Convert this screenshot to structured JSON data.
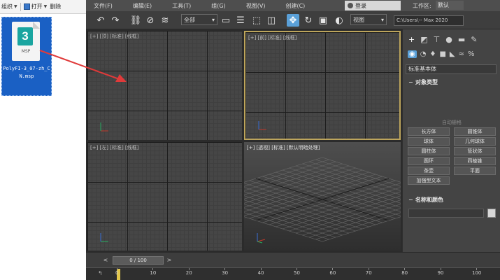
{
  "explorer": {
    "toolbar": {
      "organize": "组织",
      "open": "打开",
      "delete": "删除"
    },
    "file": {
      "badge": "3",
      "ext": "MSP",
      "name": "PolyFI-3_07-zh_CN.msp"
    }
  },
  "app": {
    "menu": [
      "文件(F)",
      "编辑(E)",
      "工具(T)",
      "组(G)",
      "视图(V)",
      "创建(C)"
    ],
    "signin_label": "登录",
    "workspace_label": "工作区:",
    "workspace_value": "默认",
    "toolbar": {
      "selection_filter": "全部",
      "view_dropdown": "视图",
      "project_path": "C:\\Users\\-- Max 2020"
    },
    "viewports": {
      "top_label": "[+] [顶] [标准] [线框]",
      "front_label": "[+] [前] [标准] [线框]",
      "left_label": "[+] [左] [标准] [线框]",
      "persp_label": "[+] [透视] [标准] [默认明暗处理]"
    },
    "command_panel": {
      "category": "标准基本体",
      "object_type_title": "对象类型",
      "autogrid": "自动栅格",
      "primitives": [
        "长方体",
        "圆锥体",
        "球体",
        "几何球体",
        "圆柱体",
        "管状体",
        "圆环",
        "四棱锥",
        "茶壶",
        "平面",
        "加强型文本"
      ],
      "name_color_title": "名称和颜色",
      "swatch_color": "#d8d8d8"
    },
    "time": {
      "slider_label": "0 / 100",
      "ticks": [
        "0",
        "10",
        "20",
        "30",
        "40",
        "50",
        "60",
        "70",
        "80",
        "90",
        "100"
      ]
    },
    "colors": {
      "active_viewport_border": "#bda55c",
      "selected_tool": "#5aa0d8",
      "time_thumb": "#e2c64a",
      "file_tile": "#1a60c4",
      "arrow": "#e03a3a"
    }
  }
}
